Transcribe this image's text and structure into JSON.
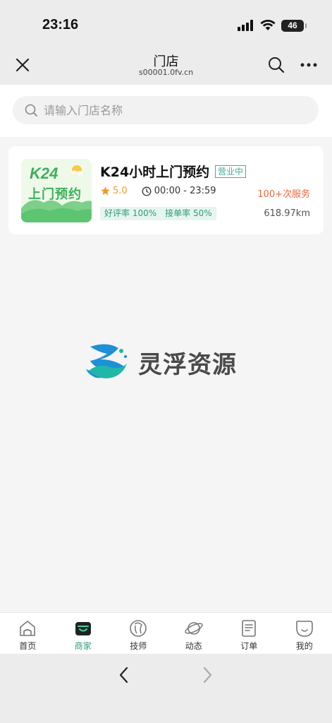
{
  "status_bar": {
    "time": "23:16",
    "battery": "46"
  },
  "nav": {
    "title": "门店",
    "subtitle": "s00001.0fv.cn"
  },
  "search": {
    "placeholder": "请输入门店名称",
    "value": ""
  },
  "store": {
    "logo_brand": "K24",
    "logo_text": "上门预约",
    "name": "K24小时上门预约",
    "status": "营业中",
    "rating": "5.0",
    "hours": "00:00 - 23:59",
    "service_count": "100+次服务",
    "good_rate": "好评率 100%",
    "accept_rate": "接单率 50%",
    "distance": "618.97km"
  },
  "watermark": {
    "text": "灵浮资源"
  },
  "tabbar": {
    "items": [
      {
        "label": "首页",
        "icon": "home-icon"
      },
      {
        "label": "商家",
        "icon": "store-icon",
        "active": true
      },
      {
        "label": "技师",
        "icon": "technician-icon"
      },
      {
        "label": "动态",
        "icon": "planet-icon"
      },
      {
        "label": "订单",
        "icon": "order-icon"
      },
      {
        "label": "我的",
        "icon": "profile-icon"
      }
    ]
  },
  "colors": {
    "accent": "#2f9c7a",
    "rating": "#f29a2e",
    "service": "#f0663a",
    "logo_green": "#3cb05a"
  }
}
